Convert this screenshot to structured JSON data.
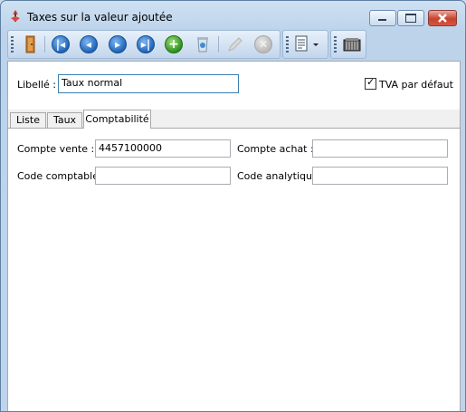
{
  "window": {
    "title": "Taxes sur la valeur ajoutée",
    "buttons": {
      "minimize": "minimize",
      "maximize": "maximize",
      "close": "close"
    }
  },
  "toolbar": {
    "icons": [
      "exit-door-icon",
      "first-record-icon",
      "previous-record-icon",
      "next-record-icon",
      "last-record-icon",
      "add-record-icon",
      "delete-record-icon",
      "edit-record-icon",
      "cancel-record-icon",
      "report-menu-icon",
      "records-view-icon"
    ]
  },
  "header": {
    "libelle_label": "Libellé :",
    "libelle_value": "Taux normal",
    "tva_default_label": "TVA par défaut",
    "tva_default_checked": true
  },
  "tabs": [
    {
      "label": "Liste",
      "active": false
    },
    {
      "label": "Taux",
      "active": false
    },
    {
      "label": "Comptabilité",
      "active": true
    }
  ],
  "comptabilite": {
    "compte_vente_label": "Compte vente :",
    "compte_vente_value": "4457100000",
    "compte_achat_label": "Compte achat :",
    "compte_achat_value": "",
    "code_comptable_label": "Code comptable :",
    "code_comptable_value": "",
    "code_analytique_label": "Code analytique :",
    "code_analytique_value": ""
  }
}
